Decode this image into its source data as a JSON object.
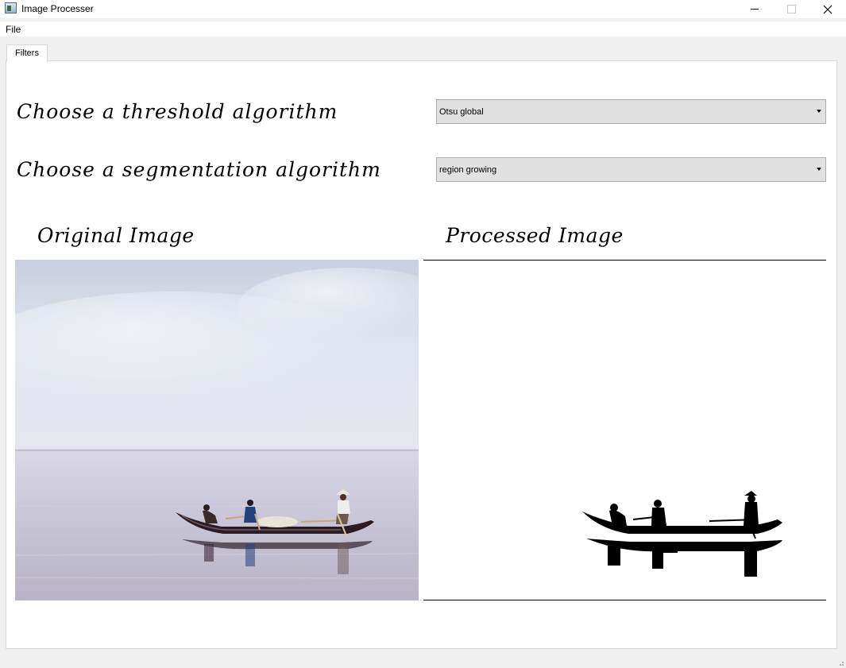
{
  "window": {
    "title": "Image Processer"
  },
  "menu": {
    "items": [
      "File"
    ]
  },
  "tabs": [
    {
      "label": "Filters",
      "selected": true
    }
  ],
  "filters": {
    "threshold_label": "Choose a threshold algorithm",
    "threshold_value": "Otsu global",
    "segmentation_label": "Choose a segmentation algorithm",
    "segmentation_value": "region growing",
    "original_label": "Original Image",
    "processed_label": "Processed Image"
  },
  "images": {
    "original": "photo-fishing-boat-on-calm-water",
    "processed": "binary-silhouette-fishing-boat"
  },
  "colors": {
    "window_bg": "#f0f0f0",
    "pane_bg": "#ffffff",
    "combo_bg": "#e1e1e1"
  }
}
